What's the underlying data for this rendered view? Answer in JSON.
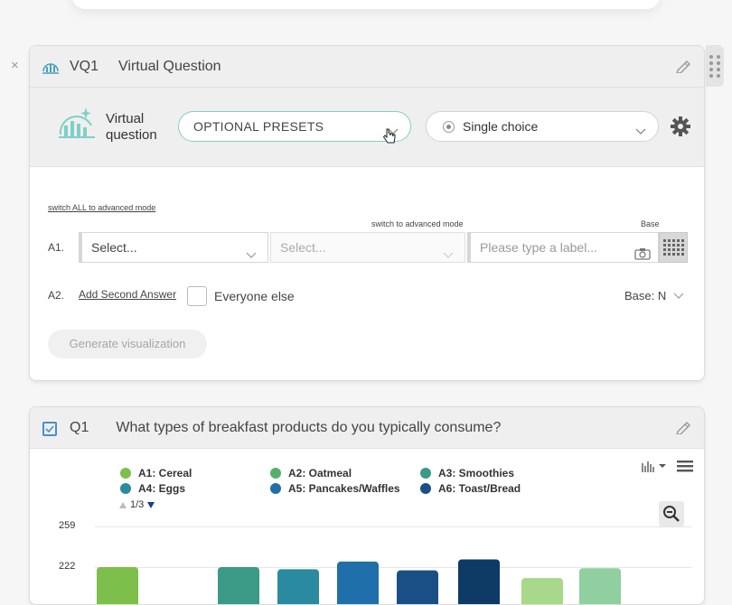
{
  "vq_card": {
    "code": "VQ1",
    "title": "Virtual Question",
    "close_label": "×",
    "vq_label_line1": "Virtual",
    "vq_label_line2": "question",
    "presets_label": "OPTIONAL PRESETS",
    "type_select": "Single choice",
    "switch_all_link": "switch ALL to advanced mode",
    "switch_link": "switch to advanced mode",
    "base_header": "Base",
    "a1_label": "A1.",
    "a1_select": "Select...",
    "a1_select2": "Select...",
    "a1_label_placeholder": "Please type a label...",
    "a2_label": "A2.",
    "add_second_answer": "Add Second Answer",
    "everyone_else": "Everyone else",
    "base_select": "Base: N",
    "generate_button": "Generate visualization"
  },
  "q1_card": {
    "code": "Q1",
    "title": "What types of breakfast products do you typically consume?",
    "pager": "1/3",
    "y_ticks": [
      "259",
      "222"
    ]
  },
  "colors": {
    "accent_teal": "#7fd0c8",
    "checkbox_blue": "#4a8fd0"
  },
  "chart_data": {
    "type": "bar",
    "legend": [
      {
        "name": "A1: Cereal",
        "color": "#7cc04b"
      },
      {
        "name": "A2: Oatmeal",
        "color": "#55b06e"
      },
      {
        "name": "A3: Smoothies",
        "color": "#3a9a86"
      },
      {
        "name": "A4: Eggs",
        "color": "#2a8aa0"
      },
      {
        "name": "A5: Pancakes/Waffles",
        "color": "#1f6fab"
      },
      {
        "name": "A6: Toast/Bread",
        "color": "#1a4f86"
      }
    ],
    "bars": [
      {
        "value": 222,
        "color": "#7cc04b"
      },
      {
        "value": 222,
        "color": "#3a9a86"
      },
      {
        "value": 220,
        "color": "#2a8aa0"
      },
      {
        "value": 227,
        "color": "#1f6fab"
      },
      {
        "value": 219,
        "color": "#1a4f86"
      },
      {
        "value": 229,
        "color": "#0e3a66"
      },
      {
        "value": 212,
        "color": "#a8d88a"
      },
      {
        "value": 221,
        "color": "#8fcfa0"
      }
    ],
    "ylim": [
      0,
      259
    ],
    "legend_placement": "top-left"
  }
}
